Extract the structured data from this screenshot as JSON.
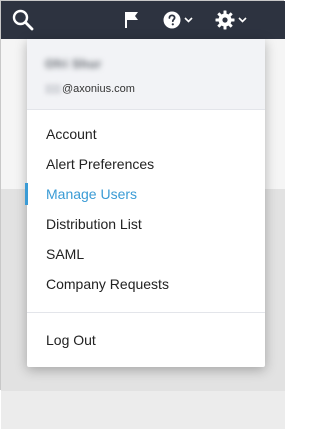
{
  "topbar": {
    "icons": [
      "search-icon",
      "flag-icon",
      "help-icon",
      "settings-icon"
    ],
    "background_color": "#2d3340"
  },
  "dropdown": {
    "user_name": "Ofri Shur",
    "email_domain": "@axonius.com",
    "items": [
      {
        "label": "Account"
      },
      {
        "label": "Alert Preferences"
      },
      {
        "label": "Manage Users",
        "active": true
      },
      {
        "label": "Distribution List"
      },
      {
        "label": "SAML"
      },
      {
        "label": "Company Requests"
      }
    ],
    "logout_label": "Log Out",
    "accent_color": "#3a9bd5"
  }
}
